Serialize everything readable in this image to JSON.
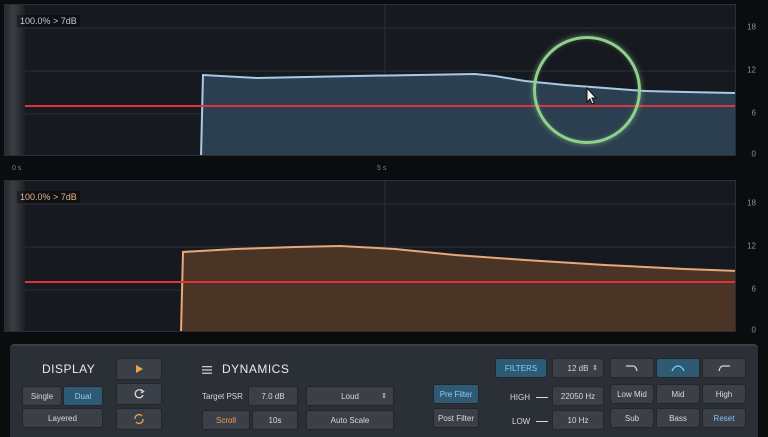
{
  "graphs": {
    "top": {
      "peak_label": "100.0% > 7dB",
      "y_ticks": [
        "18",
        "12",
        "6",
        "0"
      ],
      "time_ticks": [
        "0 s",
        "5 s"
      ],
      "line_color": "#a8cbe4",
      "fill_color": "#2c3f50",
      "threshold_color": "#e0333b"
    },
    "bottom": {
      "peak_label": "100.0% > 7dB",
      "y_ticks": [
        "18",
        "12",
        "6",
        "0"
      ],
      "line_color": "#e8a877",
      "fill_color": "#4a3426",
      "threshold_color": "#e0333b"
    }
  },
  "controls": {
    "display": {
      "title": "DISPLAY",
      "single": "Single",
      "dual": "Dual",
      "layered": "Layered"
    },
    "transport": {
      "play_icon": "play-icon",
      "reset_icon": "refresh-icon",
      "loop_icon": "loop-icon"
    },
    "dynamics": {
      "menu_icon": "menu-icon",
      "title": "DYNAMICS",
      "target_psr_label": "Target PSR",
      "target_psr_value": "7.0 dB",
      "loudness_mode": "Loud",
      "scroll": "Scroll",
      "scroll_time": "10s",
      "auto_scale": "Auto Scale"
    },
    "filters": {
      "pre_filter": "Pre Filter",
      "post_filter": "Post Filter",
      "filters_button": "FILTERS",
      "slope": "12 dB",
      "high_label": "HIGH",
      "high_value": "22050 Hz",
      "low_label": "LOW",
      "low_value": "10 Hz"
    },
    "presets": {
      "low_mid": "Low Mid",
      "mid": "Mid",
      "high": "High",
      "sub": "Sub",
      "bass": "Bass",
      "reset": "Reset"
    }
  }
}
